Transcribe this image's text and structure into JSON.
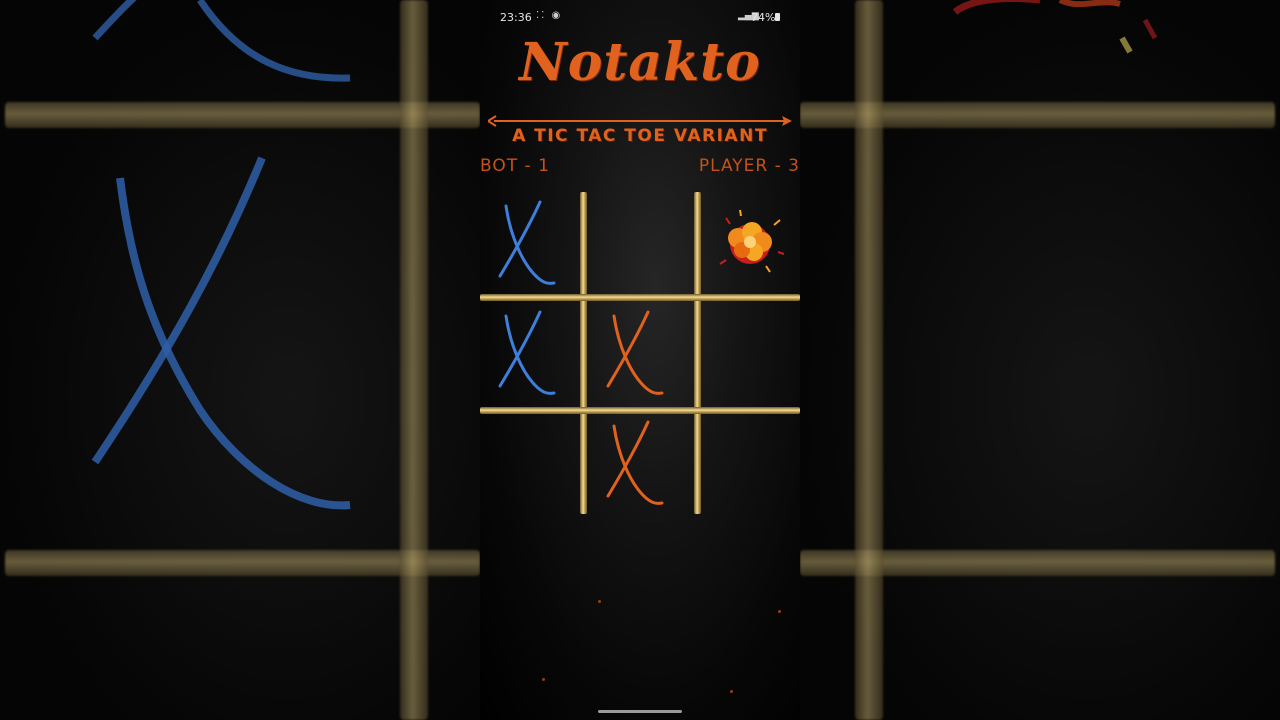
{
  "status_bar": {
    "time": "23:36",
    "battery": "74%"
  },
  "header": {
    "title": "Notakto",
    "subtitle": "A TIC TAC TOE VARIANT"
  },
  "scores": {
    "bot": "BOT - 1",
    "player": "PLAYER - 3"
  },
  "board": {
    "cells": [
      {
        "row": 0,
        "col": 0,
        "mark": "X",
        "color": "#3f7fdc"
      },
      {
        "row": 0,
        "col": 1,
        "mark": "",
        "color": ""
      },
      {
        "row": 0,
        "col": 2,
        "mark": "explosion",
        "color": "#f08a1c"
      },
      {
        "row": 1,
        "col": 0,
        "mark": "X",
        "color": "#3f7fdc"
      },
      {
        "row": 1,
        "col": 1,
        "mark": "X",
        "color": "#e0621e"
      },
      {
        "row": 1,
        "col": 2,
        "mark": "",
        "color": ""
      },
      {
        "row": 2,
        "col": 0,
        "mark": "",
        "color": ""
      },
      {
        "row": 2,
        "col": 1,
        "mark": "X",
        "color": "#e0621e"
      },
      {
        "row": 2,
        "col": 2,
        "mark": "",
        "color": ""
      }
    ]
  },
  "colors": {
    "accent": "#e0621e",
    "bot_x": "#3f7fdc",
    "player_x": "#e0621e",
    "grid": "#d8bf7a"
  }
}
